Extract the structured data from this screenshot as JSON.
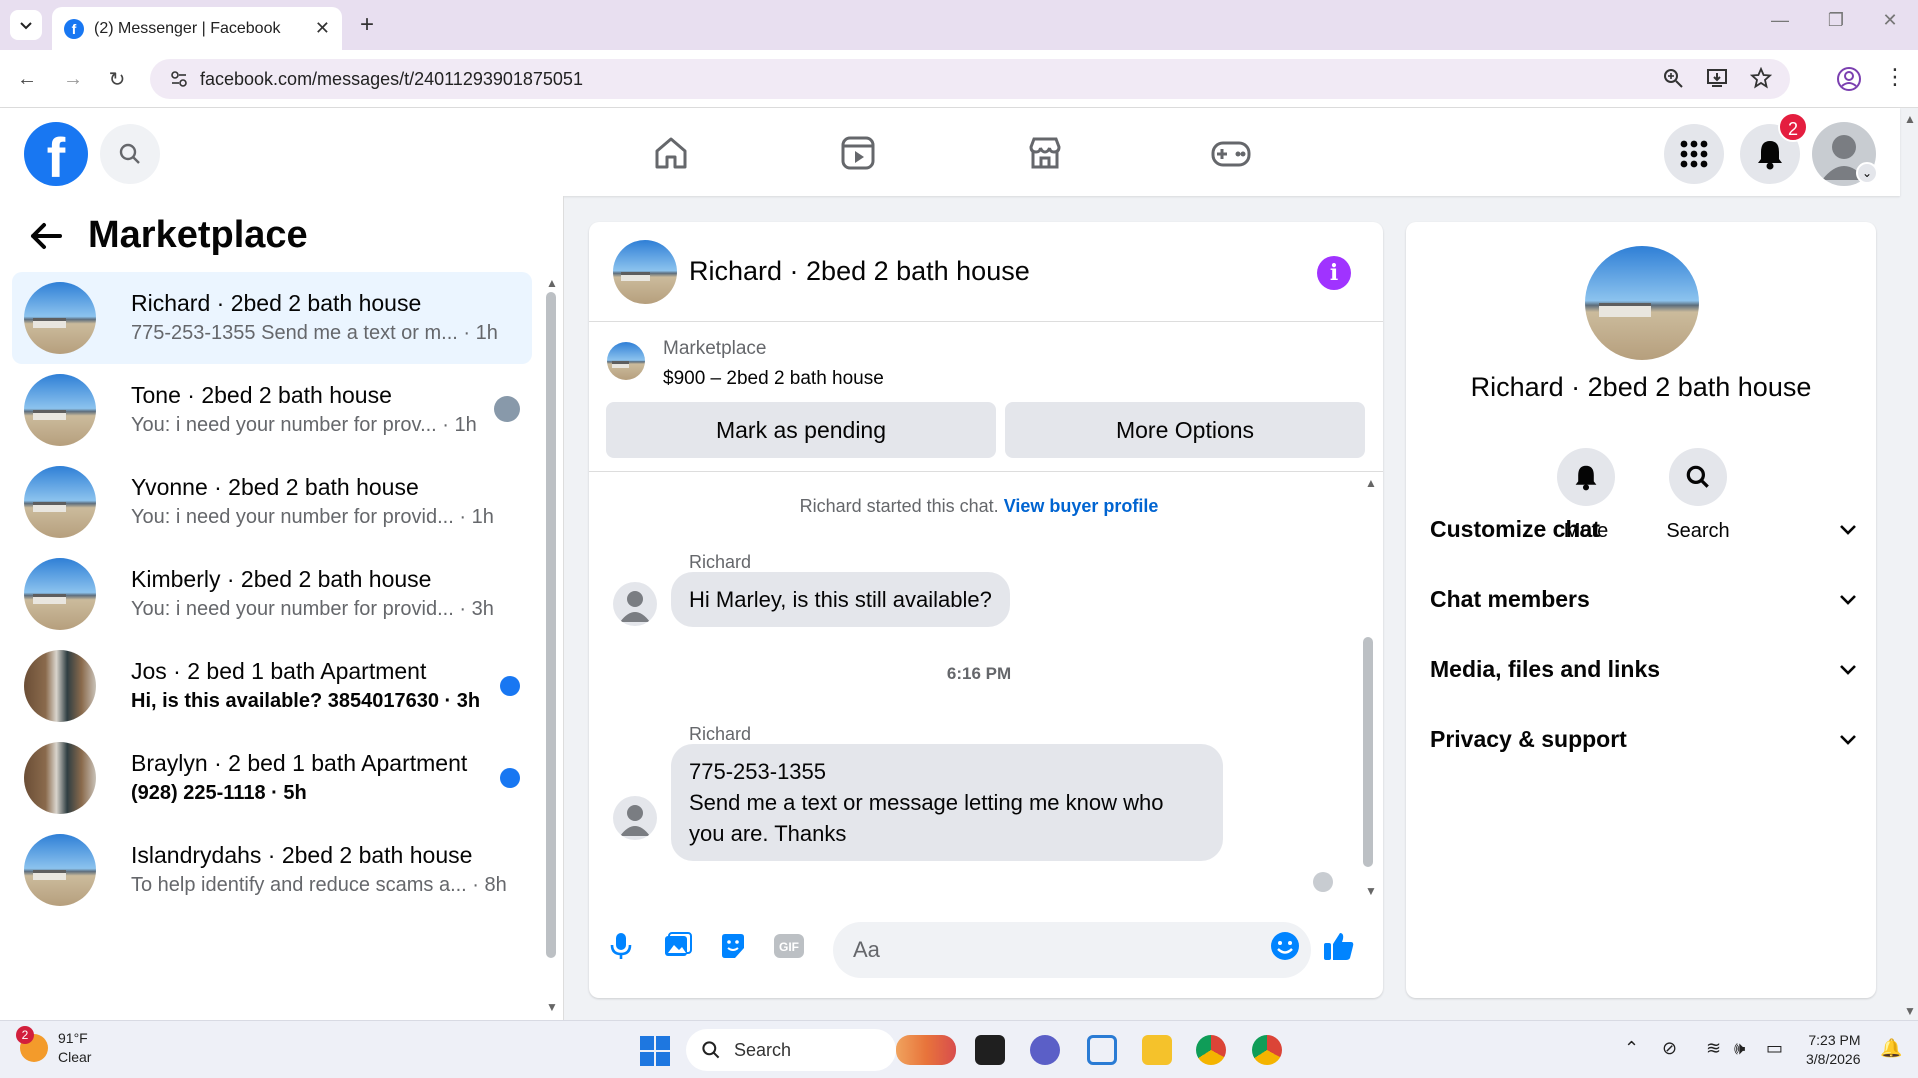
{
  "browser": {
    "tab_title": "(2) Messenger | Facebook",
    "url": "facebook.com/messages/t/24011293901875051"
  },
  "header": {
    "notification_count": "2"
  },
  "left": {
    "title": "Marketplace",
    "conversations": [
      {
        "name": "Richard · 2bed 2 bath house",
        "preview": "775-253-1355 Send me a text or m...",
        "time": "1h",
        "active": true,
        "unread": false,
        "thumb": "house"
      },
      {
        "name": "Tone · 2bed 2 bath house",
        "preview": "You: i need your number for prov...",
        "time": "1h",
        "active": false,
        "unread": false,
        "thumb": "house"
      },
      {
        "name": "Yvonne · 2bed 2 bath house",
        "preview": "You: i need your number for provid...",
        "time": "1h",
        "active": false,
        "unread": false,
        "thumb": "house"
      },
      {
        "name": "Kimberly · 2bed 2 bath house",
        "preview": "You: i need your number for provid...",
        "time": "3h",
        "active": false,
        "unread": false,
        "thumb": "house"
      },
      {
        "name": "Jos · 2 bed 1 bath Apartment",
        "preview": "Hi, is this available? 3854017630",
        "time": "3h",
        "active": false,
        "unread": true,
        "thumb": "kitchen"
      },
      {
        "name": "Braylyn · 2 bed 1 bath Apartment",
        "preview": "(928) 225-1118",
        "time": "5h",
        "active": false,
        "unread": true,
        "thumb": "kitchen"
      },
      {
        "name": "Islandrydahs · 2bed 2 bath house",
        "preview": "To help identify and reduce scams a...",
        "time": "8h",
        "active": false,
        "unread": false,
        "thumb": "house"
      }
    ]
  },
  "chat": {
    "title": "Richard · 2bed 2 bath house",
    "listing_source": "Marketplace",
    "listing_title": "$900 – 2bed 2 bath house",
    "btn_pending": "Mark as pending",
    "btn_more": "More Options",
    "started_text": "Richard started this chat.",
    "started_link": "View buyer profile",
    "sender1": "Richard",
    "msg1": "Hi Marley, is this still available?",
    "timestamp": "6:16 PM",
    "sender2": "Richard",
    "msg2_line1": "775-253-1355",
    "msg2_line2": "Send me a text or message letting me know who",
    "msg2_line3": "you are. Thanks",
    "input_placeholder": "Aa"
  },
  "right": {
    "name": "Richard · 2bed 2 bath house",
    "mute_label": "Mute",
    "search_label": "Search",
    "sections": [
      "Customize chat",
      "Chat members",
      "Media, files and links",
      "Privacy & support"
    ]
  },
  "taskbar": {
    "weather_temp": "91°F",
    "weather_desc": "Clear",
    "weather_badge": "2",
    "search_label": "Search",
    "time": "7:23 PM",
    "date": "3/8/2026"
  },
  "colors": {
    "fb_blue": "#1877f2",
    "active_row": "#ebf5ff",
    "info_purple": "#a033ff",
    "badge_red": "#e41e3f"
  }
}
